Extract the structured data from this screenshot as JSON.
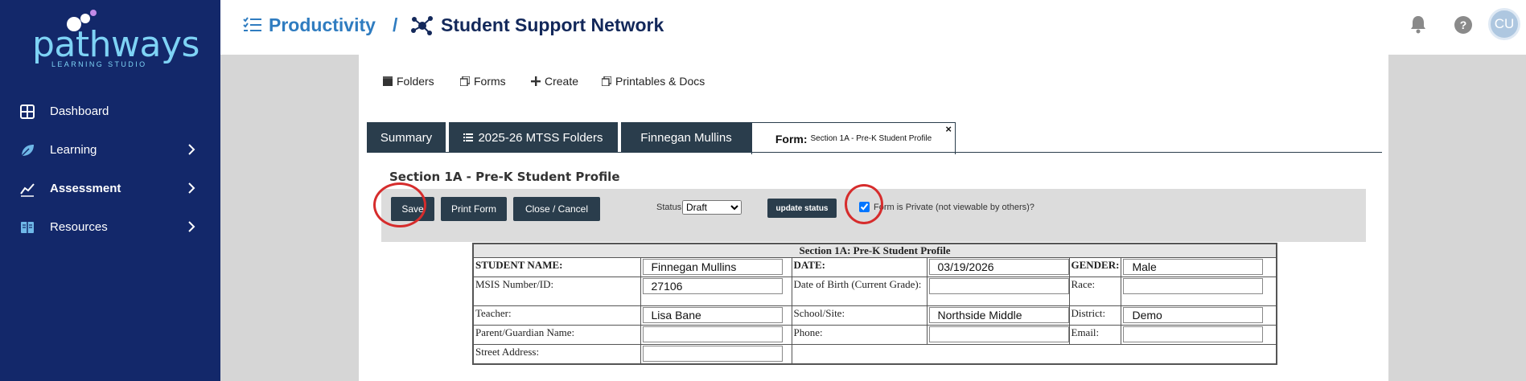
{
  "sidebar": {
    "logo": {
      "word": "pathways",
      "sub": "LEARNING STUDIO"
    },
    "items": [
      {
        "label": "Dashboard",
        "has_chevron": false,
        "bold": false
      },
      {
        "label": "Learning",
        "has_chevron": true,
        "bold": false
      },
      {
        "label": "Assessment",
        "has_chevron": true,
        "bold": true
      },
      {
        "label": "Resources",
        "has_chevron": true,
        "bold": false
      }
    ]
  },
  "header": {
    "section": "Productivity",
    "separator": "/",
    "title": "Student Support Network",
    "help_label": "?",
    "avatar_initials": "CU"
  },
  "topnav": {
    "folders": "Folders",
    "forms": "Forms",
    "create": "Create",
    "printables": "Printables & Docs"
  },
  "tabs": {
    "summary": "Summary",
    "folders": "2025-26 MTSS Folders",
    "student": "Finnegan Mullins",
    "form_prefix": "Form:",
    "form_name": "Section 1A - Pre-K Student Profile",
    "close": "×"
  },
  "form": {
    "heading": "Section 1A - Pre-K Student Profile",
    "buttons": {
      "save": "Save",
      "print": "Print Form",
      "close": "Close / Cancel",
      "update_status": "update status"
    },
    "status_label": "Status",
    "status_value": "Draft",
    "private_label": "Form is Private (not viewable by others)?",
    "private_checked": true
  },
  "table": {
    "caption": "Section 1A: Pre-K Student Profile",
    "labels": {
      "student_name": "STUDENT NAME:",
      "date": "DATE:",
      "gender": "GENDER:",
      "msis": "MSIS Number/ID:",
      "dob": "Date of Birth (Current Grade):",
      "race": "Race:",
      "teacher": "Teacher:",
      "school": "School/Site:",
      "district": "District:",
      "parent": "Parent/Guardian Name:",
      "phone": "Phone:",
      "email": "Email:",
      "street": "Street Address:"
    },
    "values": {
      "student_name": "Finnegan Mullins",
      "date": "03/19/2026",
      "gender": "Male",
      "msis": "27106",
      "dob": "",
      "race": "",
      "teacher": "Lisa Bane",
      "school": "Northside Middle",
      "district": "Demo",
      "parent": "",
      "phone": "",
      "email": "",
      "street": ""
    }
  },
  "colors": {
    "sidebar": "#13286a",
    "accent_blue": "#2f7cc0",
    "dark_button": "#2a3d4c",
    "highlight_circle": "#d62c2c"
  }
}
